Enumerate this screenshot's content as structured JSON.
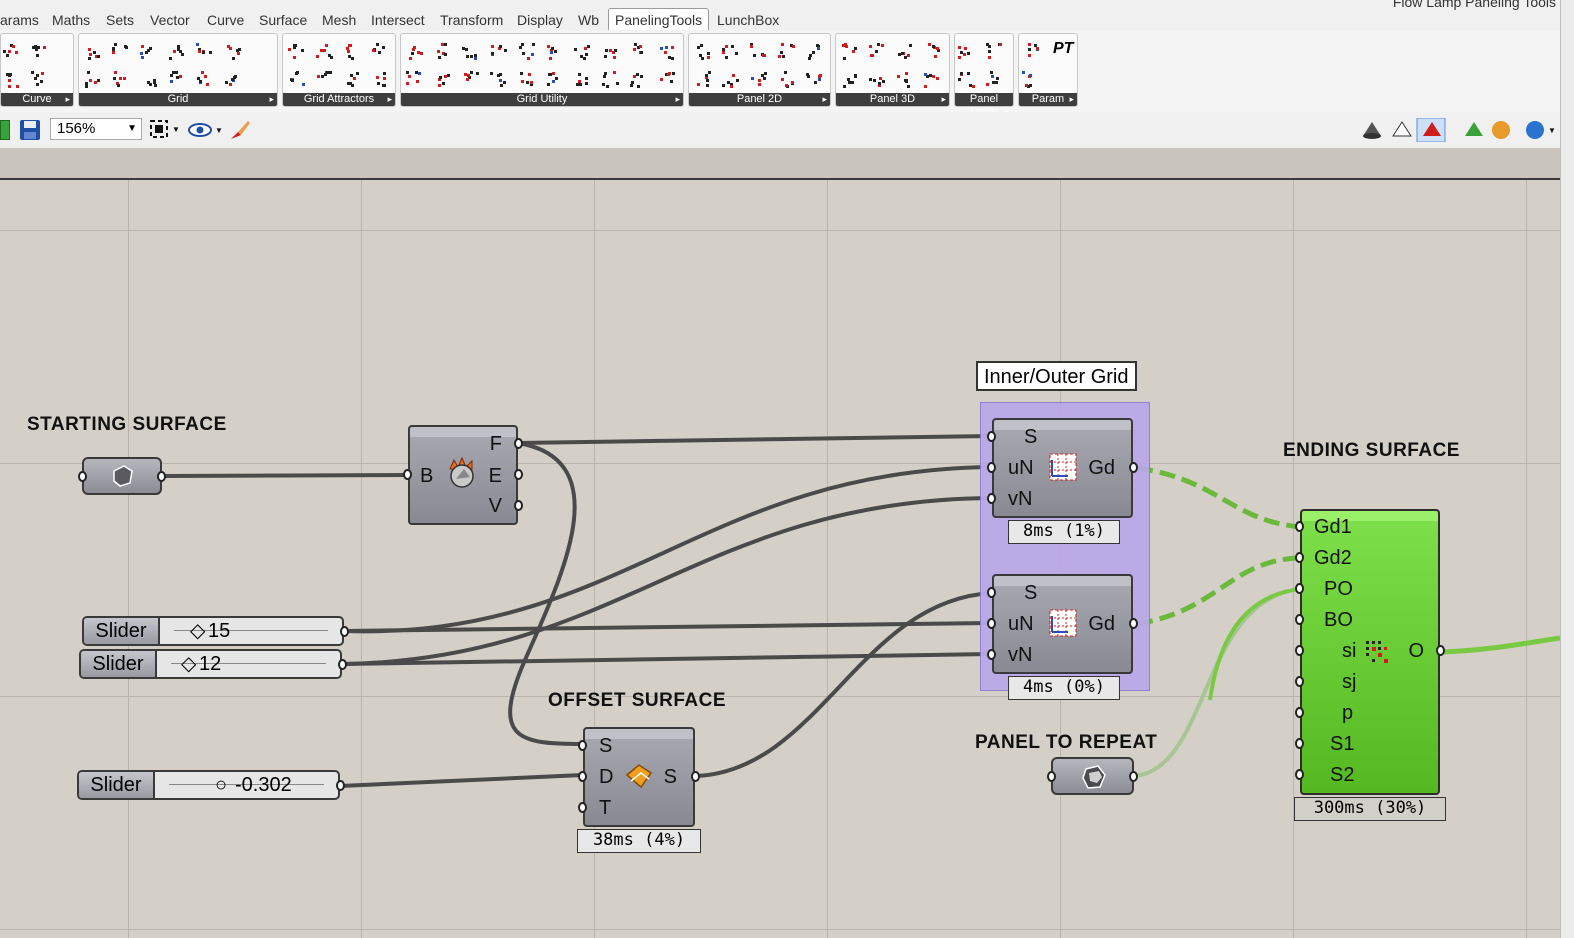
{
  "tabs": [
    "arams",
    "Maths",
    "Sets",
    "Vector",
    "Curve",
    "Surface",
    "Mesh",
    "Intersect",
    "Transform",
    "Display",
    "Wb",
    "PanelingTools",
    "LunchBox"
  ],
  "active_tab": "PanelingTools",
  "window_title": "Flow Lamp Paneling Tools",
  "ribbon_groups": [
    "Curve",
    "Grid",
    "Grid Attractors",
    "Grid Utility",
    "Panel 2D",
    "Panel 3D",
    "Panel Utility",
    "Param"
  ],
  "ribbon_pt": "PT",
  "toolbar": {
    "zoom": "156%"
  },
  "canvas": {
    "headings": {
      "starting": "STARTING SURFACE",
      "offset": "OFFSET SURFACE",
      "panel": "PANEL TO REPEAT",
      "ending": "ENDING SURFACE"
    },
    "brep_node": {
      "input": "B",
      "outputs": [
        "F",
        "E",
        "V"
      ]
    },
    "sliders": [
      {
        "name": "Slider",
        "value": "15"
      },
      {
        "name": "Slider",
        "value": "12"
      },
      {
        "name": "Slider",
        "value": "-0.302"
      }
    ],
    "offset_node": {
      "inputs": [
        "S",
        "D",
        "T"
      ],
      "output": "S",
      "timer": "38ms (4%)"
    },
    "grid_group": {
      "title": "Inner/Outer Grid"
    },
    "grid_nodes": [
      {
        "inputs": [
          "S",
          "uN",
          "vN"
        ],
        "output": "Gd",
        "timer": "8ms (1%)"
      },
      {
        "inputs": [
          "S",
          "uN",
          "vN"
        ],
        "output": "Gd",
        "timer": "4ms (0%)"
      }
    ],
    "panel_node": {
      "inputs": [
        "Gd1",
        "Gd2",
        "PO",
        "BO",
        "si",
        "sj",
        "p",
        "S1",
        "S2"
      ],
      "output": "O",
      "timer": "300ms (30%)"
    }
  },
  "colors": {
    "wire_dark": "#4a4a4a",
    "wire_green": "#7ac943",
    "panel_green": "#5ec42a",
    "group_purple": "#b9a8e8"
  }
}
